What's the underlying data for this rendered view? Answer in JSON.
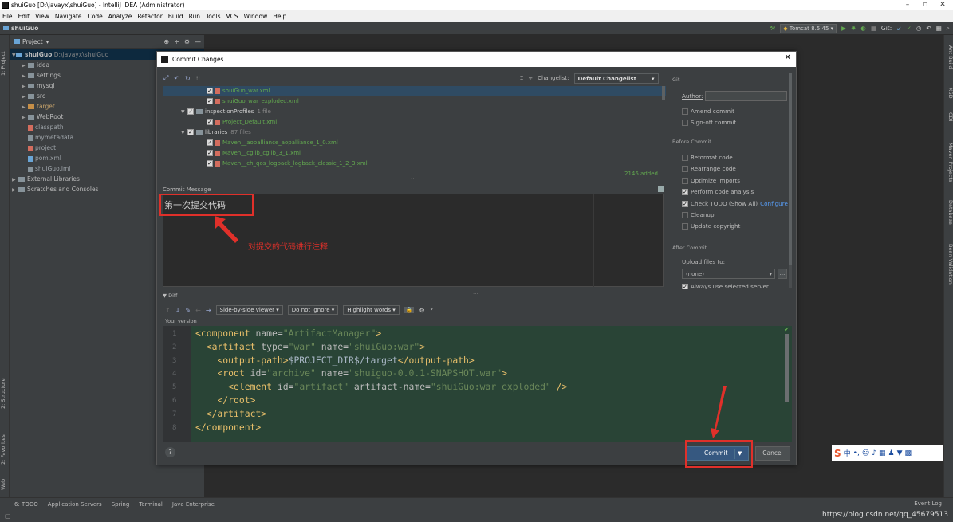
{
  "window": {
    "title": "shuiGuo [D:\\javayx\\shuiGuo] - IntelliJ IDEA (Administrator)",
    "controls": [
      "–",
      "▫",
      "✕"
    ]
  },
  "menu": [
    "File",
    "Edit",
    "View",
    "Navigate",
    "Code",
    "Analyze",
    "Refactor",
    "Build",
    "Run",
    "Tools",
    "VCS",
    "Window",
    "Help"
  ],
  "navbar": {
    "project": "shuiGuo",
    "run_config": "Tomcat 8.5.45",
    "git_label": "Git:"
  },
  "left_tool_tabs": [
    "1: Project",
    "2: Structure",
    "2: Favorites",
    "Web"
  ],
  "right_tool_tabs": [
    "Ant Build",
    "XSD",
    "CDI",
    "Maven Projects",
    "Database",
    "Bean Validation"
  ],
  "project_panel": {
    "header": "Project",
    "root_name": "shuiGuo",
    "root_path": "D:\\javayx\\shuiGuo",
    "items": [
      {
        "label": "idea",
        "level": 1,
        "arrow": "▶",
        "kind": "folder"
      },
      {
        "label": "settings",
        "level": 1,
        "arrow": "▶",
        "kind": "folder"
      },
      {
        "label": "mysql",
        "level": 1,
        "arrow": "▶",
        "kind": "folder"
      },
      {
        "label": "src",
        "level": 1,
        "arrow": "▶",
        "kind": "folder"
      },
      {
        "label": "target",
        "level": 1,
        "arrow": "▶",
        "kind": "folder-orange",
        "selected": true
      },
      {
        "label": "WebRoot",
        "level": 1,
        "arrow": "▶",
        "kind": "folder"
      },
      {
        "label": "classpath",
        "level": 1,
        "arrow": "",
        "kind": "file-red",
        "dim": true
      },
      {
        "label": "mymetadata",
        "level": 1,
        "arrow": "",
        "kind": "file",
        "dim": true
      },
      {
        "label": "project",
        "level": 1,
        "arrow": "",
        "kind": "file-red",
        "dim": true
      },
      {
        "label": "pom.xml",
        "level": 1,
        "arrow": "",
        "kind": "file-blue",
        "dim": true
      },
      {
        "label": "shuiGuo.iml",
        "level": 1,
        "arrow": "",
        "kind": "file",
        "dim": true
      },
      {
        "label": "External Libraries",
        "level": 0,
        "arrow": "▶",
        "kind": "lib"
      },
      {
        "label": "Scratches and Consoles",
        "level": 0,
        "arrow": "▶",
        "kind": "lib"
      }
    ]
  },
  "dialog": {
    "title": "Commit Changes",
    "close": "✕",
    "changelist_label": "Changelist:",
    "changelist_value": "Default Changelist",
    "files": [
      {
        "indent": 2,
        "arrow": "",
        "checked": true,
        "label": "shuiGuo_war.xml",
        "color": "green",
        "count": "",
        "selected": true
      },
      {
        "indent": 2,
        "arrow": "",
        "checked": true,
        "label": "shuiGuo_war_exploded.xml",
        "color": "green",
        "count": ""
      },
      {
        "indent": 1,
        "arrow": "▼",
        "checked": true,
        "label": "inspectionProfiles",
        "color": "white",
        "count": "1 file"
      },
      {
        "indent": 2,
        "arrow": "",
        "checked": true,
        "label": "Project_Default.xml",
        "color": "green",
        "count": ""
      },
      {
        "indent": 1,
        "arrow": "▼",
        "checked": true,
        "label": "libraries",
        "color": "white",
        "count": "87 files"
      },
      {
        "indent": 2,
        "arrow": "",
        "checked": true,
        "label": "Maven__aopalliance_aopalliance_1_0.xml",
        "color": "green",
        "count": ""
      },
      {
        "indent": 2,
        "arrow": "",
        "checked": true,
        "label": "Maven__cglib_cglib_3_1.xml",
        "color": "green",
        "count": ""
      },
      {
        "indent": 2,
        "arrow": "",
        "checked": true,
        "label": "Maven__ch_qos_logback_logback_classic_1_2_3.xml",
        "color": "green",
        "count": ""
      }
    ],
    "added_count": "2146 added",
    "commit_message_label": "Commit Message",
    "commit_message": "第一次提交代码",
    "annotation_text": "对提交的代码进行注释",
    "git_panel": {
      "section_git": "Git",
      "author_label": "Author:",
      "amend": "Amend commit",
      "signoff": "Sign-off commit",
      "section_before": "Before Commit",
      "before": [
        {
          "label": "Reformat code",
          "checked": false
        },
        {
          "label": "Rearrange code",
          "checked": false
        },
        {
          "label": "Optimize imports",
          "checked": false
        },
        {
          "label": "Perform code analysis",
          "checked": true
        },
        {
          "label": "Check TODO (Show All)",
          "checked": true,
          "link": "Configure"
        },
        {
          "label": "Cleanup",
          "checked": false
        },
        {
          "label": "Update copyright",
          "checked": false
        }
      ],
      "section_after": "After Commit",
      "upload_label": "Upload files to:",
      "upload_value": "(none)",
      "upload_btn": "...",
      "always_use": "Always use selected server"
    },
    "diff": {
      "label": "Diff",
      "viewer": "Side-by-side viewer",
      "ignore": "Do not ignore",
      "highlight": "Highlight words",
      "help": "?",
      "your_version": "Your version",
      "line_numbers": [
        "1",
        "2",
        "3",
        "4",
        "5",
        "6",
        "7",
        "8"
      ]
    },
    "buttons": {
      "help": "?",
      "commit": "Commit",
      "commit_arrow": "▼",
      "cancel": "Cancel"
    }
  },
  "code_lines": [
    {
      "indent": "",
      "parts": [
        [
          "tag",
          "<component "
        ],
        [
          "attr",
          "name="
        ],
        [
          "val",
          "\"ArtifactManager\""
        ],
        [
          "tag",
          ">"
        ]
      ]
    },
    {
      "indent": "  ",
      "parts": [
        [
          "tag",
          "<artifact "
        ],
        [
          "attr",
          "type="
        ],
        [
          "val",
          "\"war\" "
        ],
        [
          "attr",
          "name="
        ],
        [
          "val",
          "\"shuiGuo:war\""
        ],
        [
          "tag",
          ">"
        ]
      ]
    },
    {
      "indent": "    ",
      "parts": [
        [
          "tag",
          "<output-path>"
        ],
        [
          "txt",
          "$PROJECT_DIR$/target"
        ],
        [
          "tag",
          "</output-path>"
        ]
      ]
    },
    {
      "indent": "    ",
      "parts": [
        [
          "tag",
          "<root "
        ],
        [
          "attr",
          "id="
        ],
        [
          "val",
          "\"archive\" "
        ],
        [
          "attr",
          "name="
        ],
        [
          "val",
          "\"shuiguo-0.0.1-SNAPSHOT.war\""
        ],
        [
          "tag",
          ">"
        ]
      ]
    },
    {
      "indent": "      ",
      "parts": [
        [
          "tag",
          "<element "
        ],
        [
          "attr",
          "id="
        ],
        [
          "val",
          "\"artifact\" "
        ],
        [
          "attr",
          "artifact-name="
        ],
        [
          "val",
          "\"shuiGuo:war exploded\" "
        ],
        [
          "tag",
          "/>"
        ]
      ]
    },
    {
      "indent": "    ",
      "parts": [
        [
          "tag",
          "</root>"
        ]
      ]
    },
    {
      "indent": "  ",
      "parts": [
        [
          "tag",
          "</artifact>"
        ]
      ]
    },
    {
      "indent": "",
      "parts": [
        [
          "tag",
          "</component>"
        ]
      ]
    }
  ],
  "bottom_tabs": [
    "6: TODO",
    "Application Servers",
    "Spring",
    "Terminal",
    "Java Enterprise"
  ],
  "event_log": "Event Log",
  "watermark": "https://blog.csdn.net/qq_45679513",
  "ime_label": "中",
  "colors": {
    "accent": "#365880",
    "annotation": "#e0302a",
    "added": "#62a84f"
  }
}
